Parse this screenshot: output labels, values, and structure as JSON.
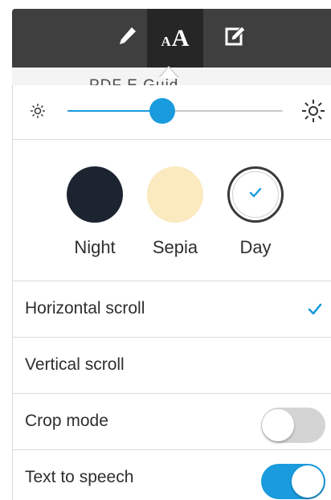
{
  "toolbar": {
    "items": [
      {
        "id": "highlight",
        "icon": "pencil-icon"
      },
      {
        "id": "text-settings",
        "icon": "font-size-icon",
        "label_small": "A",
        "label_big": "A",
        "selected": true
      },
      {
        "id": "notes",
        "icon": "edit-note-icon"
      }
    ]
  },
  "document_strip": {
    "text": "PDF E      Guid"
  },
  "brightness": {
    "min_icon": "sun-small-icon",
    "max_icon": "sun-large-icon",
    "value_fraction": 0.44,
    "accent": "#1a9bde"
  },
  "themes": [
    {
      "label": "Night",
      "color": "#1c2430",
      "selected": false
    },
    {
      "label": "Sepia",
      "color": "#fbe9bf",
      "selected": false
    },
    {
      "label": "Day",
      "color": "#ffffff",
      "selected": true
    }
  ],
  "options": {
    "horizontal_scroll": {
      "label": "Horizontal scroll",
      "checked": true
    },
    "vertical_scroll": {
      "label": "Vertical scroll",
      "checked": false
    },
    "crop_mode": {
      "label": "Crop mode",
      "on": false
    },
    "text_to_speech": {
      "label": "Text to speech",
      "on": true
    }
  }
}
